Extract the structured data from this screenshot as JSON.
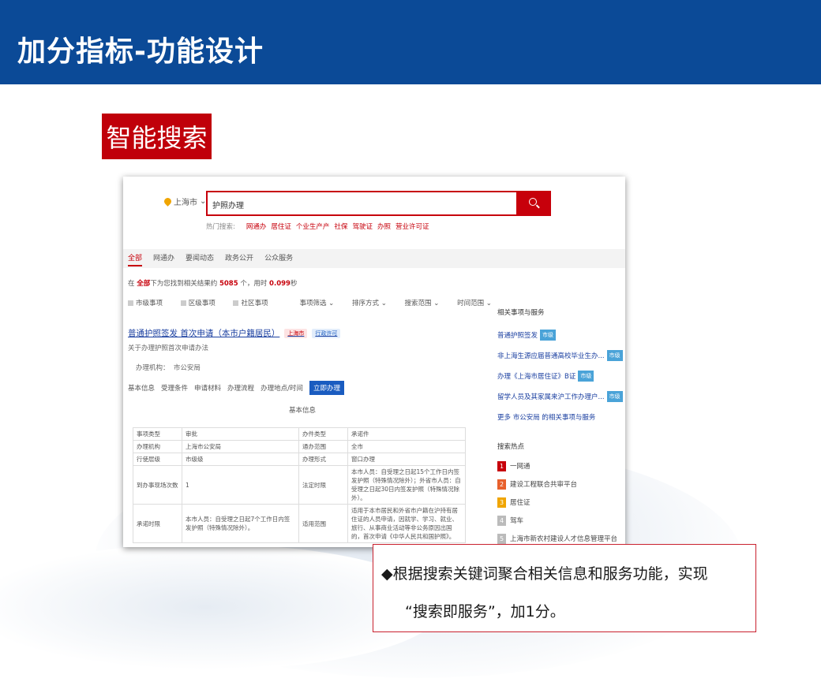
{
  "header": {
    "title": "加分指标-功能设计"
  },
  "tag": {
    "label": "智能搜索"
  },
  "screenshot": {
    "location": "上海市",
    "search_query": "护照办理",
    "hot_search": {
      "label": "热门搜索:",
      "keywords": [
        "网通办",
        "居住证",
        "个业生产产",
        "社保",
        "驾驶证",
        "办照",
        "营业许可证"
      ]
    },
    "tabs": [
      "全部",
      "网通办",
      "要闻动态",
      "政务公开",
      "公众服务"
    ],
    "result_count": {
      "prefix": "在",
      "scope": "全部",
      "middle": "下为您找到相关结果约",
      "count": "5085",
      "suffix": "个，用时",
      "time": "0.099",
      "unit": "秒"
    },
    "filters": {
      "left": [
        "市级事项",
        "区级事项",
        "社区事项"
      ],
      "right": [
        "事项筛选",
        "排序方式",
        "搜索范围",
        "时间范围"
      ]
    },
    "result": {
      "title": "普通护照签发 首次申请（本市户籍居民）",
      "badge_city": "上海市",
      "badge_type": "行政许可",
      "desc": "关于办理护照首次申请办法",
      "org_label": "办理机构：",
      "org": "市公安局",
      "actions": [
        "基本信息",
        "受理条件",
        "申请材料",
        "办理流程",
        "办理地点/时间"
      ],
      "primary_action": "立即办理",
      "basic_info_label": "基本信息"
    },
    "table": [
      [
        "事项类型",
        "审批",
        "办件类型",
        "承诺件"
      ],
      [
        "办理机构",
        "上海市公安局",
        "通办范围",
        "全市"
      ],
      [
        "行使层级",
        "市级级",
        "办理形式",
        "窗口办理"
      ],
      [
        "到办事现场次数",
        "1",
        "法定时限",
        "本市人员：自受理之日起15个工作日内签发护照（特殊情况除外）；外省市人员：自受理之日起30日内签发护照（特殊情况除外）。"
      ],
      [
        "承诺时限",
        "本市人员：自受理之日起7个工作日内签发护照（特殊情况除外）。",
        "适用范围",
        "适用于本市居民和外省市户籍在沪持有居住证的人员申请，因就学、学习、就业、旅行、从事商业活动等非公务原因出国的，首次申请《中华人民共和国护照》。"
      ]
    ],
    "sidebar": {
      "heading": "相关事项与服务",
      "links": [
        {
          "text": "普通护照签发",
          "tag": "市级"
        },
        {
          "text": "非上海生源应届普通高校毕业生办...",
          "tag": "市级"
        },
        {
          "text": "办理《上海市居住证》B证",
          "tag": "市级"
        },
        {
          "text": "留学人员及其家属来沪工作办理户...",
          "tag": "市级"
        },
        {
          "text": "更多 市公安局 的相关事项与服务",
          "tag": ""
        }
      ],
      "hot_heading": "搜索热点",
      "hot_items": [
        "一网通",
        "建设工程联合共审平台",
        "居住证",
        "驾车",
        "上海市新农村建设人才信息管理平台"
      ],
      "rank_colors": [
        "#c7000b",
        "#e8602c",
        "#f0a500",
        "#bbbbbb",
        "#bbbbbb"
      ]
    }
  },
  "note": {
    "line1": "◆根据搜索关键词聚合相关信息和服务功能，实现",
    "line2": "“搜索即服务”，加1分。"
  }
}
